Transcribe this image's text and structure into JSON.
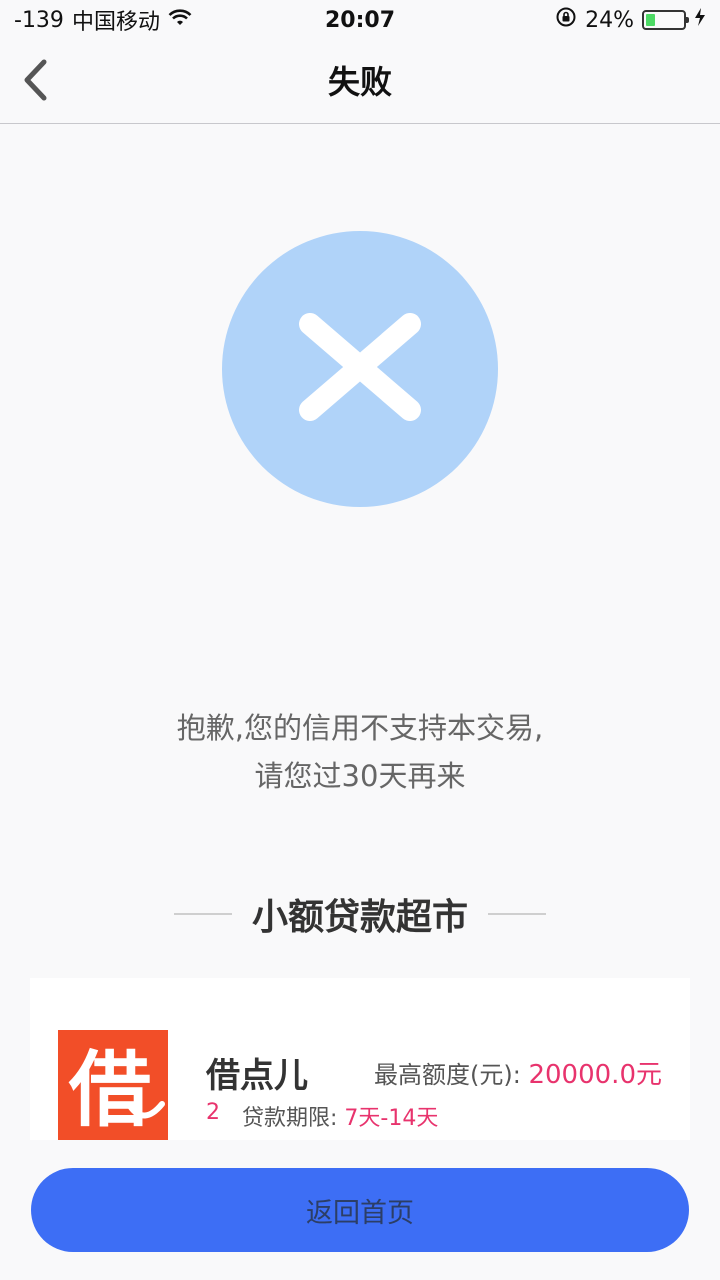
{
  "status_bar": {
    "signal": "-139",
    "carrier": "中国移动",
    "time": "20:07",
    "battery_percent": "24%",
    "battery_level": 0.24,
    "icons": [
      "wifi-icon",
      "rotation-lock-icon",
      "battery-icon",
      "charging-icon"
    ]
  },
  "nav": {
    "title": "失败",
    "back_icon": "chevron-left-icon"
  },
  "result": {
    "icon": "close-icon",
    "icon_color": "#b0d3f9",
    "message_line1": "抱歉,您的信用不支持本交易,",
    "message_line2": "请您过30天再来"
  },
  "section": {
    "title": "小额贷款超市"
  },
  "loan_card": {
    "logo_text": "借",
    "name": "借点儿",
    "limit_label": "最高额度(元):",
    "limit_value": "20000.0元",
    "rank": "2",
    "term_label": "贷款期限:",
    "term_value": "7天-14天",
    "accent_color": "#e8336d",
    "logo_color": "#f24e28"
  },
  "footer": {
    "home_button_label": "返回首页",
    "button_color": "#3d6ef5"
  }
}
